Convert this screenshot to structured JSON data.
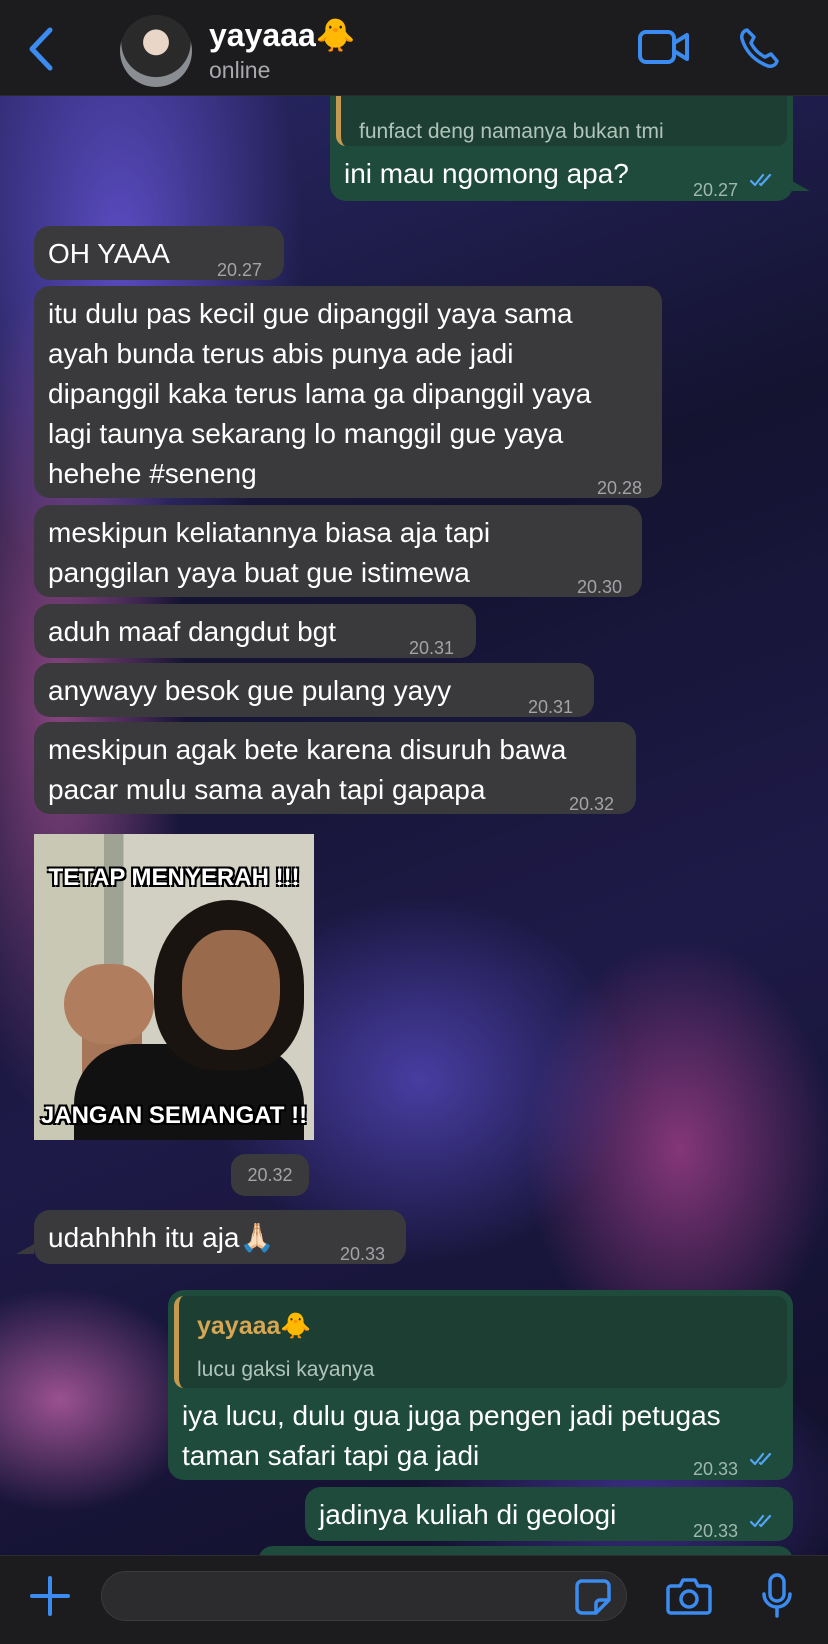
{
  "header": {
    "contact_name": "yayaaa🐥",
    "status": "online"
  },
  "messages": [
    {
      "id": "m0",
      "dir": "out",
      "reply_text": "funfact deng namanya bukan tmi",
      "lines": [
        "ini mau ngomong apa?"
      ],
      "time": "20.27",
      "read": true
    },
    {
      "id": "m1",
      "dir": "in",
      "lines": [
        "OH YAAA"
      ],
      "time": "20.27"
    },
    {
      "id": "m2",
      "dir": "in",
      "lines": [
        "itu dulu pas kecil gue dipanggil yaya sama",
        "ayah bunda terus abis punya ade jadi",
        "dipanggil kaka terus lama ga dipanggil yaya",
        "lagi taunya sekarang lo manggil gue yaya",
        "hehehe #seneng"
      ],
      "time": "20.28"
    },
    {
      "id": "m3",
      "dir": "in",
      "lines": [
        "meskipun keliatannya biasa aja tapi",
        "panggilan yaya buat gue istimewa"
      ],
      "time": "20.30"
    },
    {
      "id": "m4",
      "dir": "in",
      "lines": [
        "aduh maaf dangdut bgt"
      ],
      "time": "20.31"
    },
    {
      "id": "m5",
      "dir": "in",
      "lines": [
        "anywayy besok gue pulang yayy"
      ],
      "time": "20.31"
    },
    {
      "id": "m6",
      "dir": "in",
      "lines": [
        "meskipun agak bete karena disuruh bawa",
        "pacar mulu sama ayah tapi gapapa"
      ],
      "time": "20.32"
    },
    {
      "id": "m8",
      "dir": "in",
      "lines": [
        "udahhhh itu aja🙏🏻"
      ],
      "time": "20.33"
    },
    {
      "id": "m9",
      "dir": "out",
      "reply_name": "yayaaa🐥",
      "reply_text": "lucu gaksi kayanya",
      "lines": [
        "iya lucu, dulu gua juga pengen jadi petugas",
        "taman safari tapi ga jadi"
      ],
      "time": "20.33",
      "read": true
    },
    {
      "id": "m10",
      "dir": "out",
      "lines": [
        "jadinya kuliah di geologi"
      ],
      "time": "20.33",
      "read": true
    }
  ],
  "image_message": {
    "caption_top": "TETAP MENYERAH !!!",
    "caption_bottom": "JANGAN SEMANGAT !!",
    "time": "20.32"
  },
  "composer": {
    "placeholder": ""
  },
  "icons": {
    "back": "chevron-left-icon",
    "video": "video-camera-icon",
    "call": "phone-icon",
    "attach": "plus-icon",
    "sticker": "sticker-icon",
    "camera": "camera-icon",
    "voice": "microphone-icon"
  },
  "colors": {
    "accent": "#3b8bf0",
    "outgoing_bubble": "#1e4b3c",
    "incoming_bubble": "#3a3a3c",
    "reply_name": "#d7a653",
    "read_ticks": "#53a6f5"
  }
}
